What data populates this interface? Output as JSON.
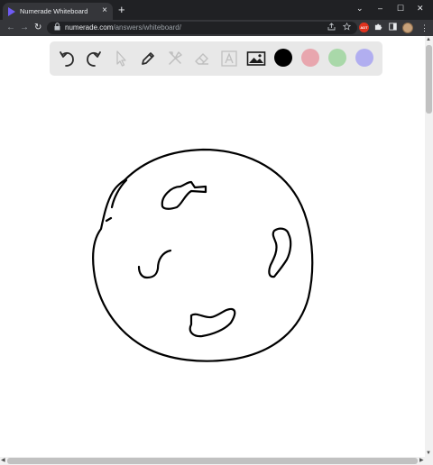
{
  "browser": {
    "tab_title": "Numerade Whiteboard",
    "tab_close": "×",
    "new_tab": "+",
    "win_min": "–",
    "win_max": "☐",
    "win_close": "✕",
    "tabs_menu": "⌄",
    "back": "←",
    "forward": "→",
    "reload": "↻",
    "url_host": "numerade.com",
    "url_path": "/answers/whiteboard/",
    "extension_badge": "ADT",
    "menu": "⋮"
  },
  "toolbar": {
    "tools": [
      {
        "name": "undo-icon"
      },
      {
        "name": "redo-icon"
      },
      {
        "name": "select-pointer-icon"
      },
      {
        "name": "pen-icon"
      },
      {
        "name": "tools-icon"
      },
      {
        "name": "eraser-icon"
      },
      {
        "name": "text-icon"
      },
      {
        "name": "image-icon"
      }
    ],
    "colors": [
      "#000000",
      "#e8a6ae",
      "#a9d8a9",
      "#b1aef0"
    ]
  }
}
